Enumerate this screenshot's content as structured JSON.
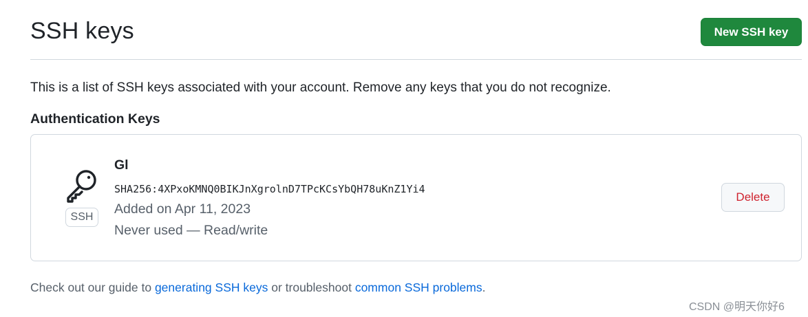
{
  "header": {
    "title": "SSH keys",
    "new_key_label": "New SSH key"
  },
  "intro": "This is a list of SSH keys associated with your account. Remove any keys that you do not recognize.",
  "section": {
    "heading": "Authentication Keys"
  },
  "keys": [
    {
      "icon": "key-icon",
      "type_label": "SSH",
      "title": "Gl",
      "fingerprint": "SHA256:4XPxoKMNQ0BIKJnXgrolnD7TPcKCsYbQH78uKnZ1Yi4",
      "added": "Added on Apr 11, 2023",
      "usage": "Never used — Read/write",
      "delete_label": "Delete"
    }
  ],
  "footer": {
    "prefix": "Check out our guide to ",
    "link1": "generating SSH keys",
    "middle": " or troubleshoot ",
    "link2": "common SSH problems",
    "suffix": "."
  },
  "watermark": "CSDN @明天你好6",
  "colors": {
    "primary_button": "#1f883d",
    "danger_text": "#cf222e",
    "link": "#0969da",
    "muted_text": "#57606a",
    "border": "#d0d7de"
  }
}
